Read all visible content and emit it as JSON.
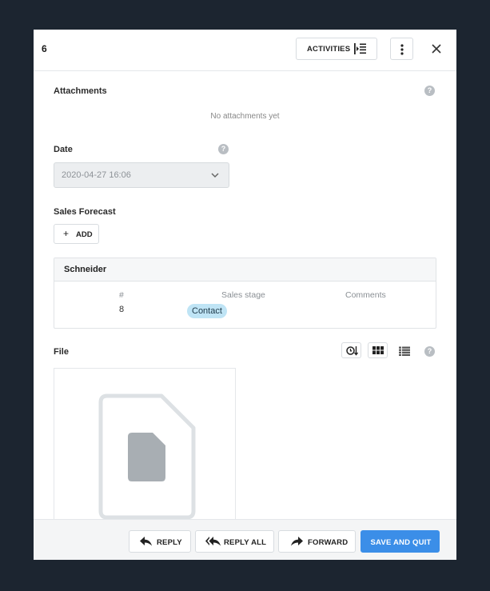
{
  "header": {
    "record_id": "6",
    "activities_label": "ACTIVITIES"
  },
  "attachments": {
    "label": "Attachments",
    "empty_text": "No attachments yet"
  },
  "date_field": {
    "label": "Date",
    "value": "2020-04-27 16:06"
  },
  "sales_forecast": {
    "label": "Sales Forecast",
    "add_label": "ADD",
    "group_title": "Schneider",
    "columns": [
      "#",
      "Sales stage",
      "Comments"
    ],
    "rows": [
      {
        "number": "8",
        "sales_stage": "Contact",
        "comments": ""
      }
    ],
    "stage_color": "#bfe4f5"
  },
  "file": {
    "label": "File"
  },
  "footer": {
    "reply_label": "REPLY",
    "reply_all_label": "REPLY ALL",
    "forward_label": "FORWARD",
    "save_quit_label": "SAVE AND QUIT",
    "primary_color": "#3b8ee8"
  },
  "icons": [
    "activities-panel-icon",
    "more-vertical-icon",
    "close-icon",
    "help-icon",
    "chevron-down-icon",
    "plus-icon",
    "sort-time-icon",
    "grid-view-icon",
    "list-view-icon",
    "file-placeholder-icon",
    "reply-icon",
    "reply-all-icon",
    "forward-icon"
  ]
}
